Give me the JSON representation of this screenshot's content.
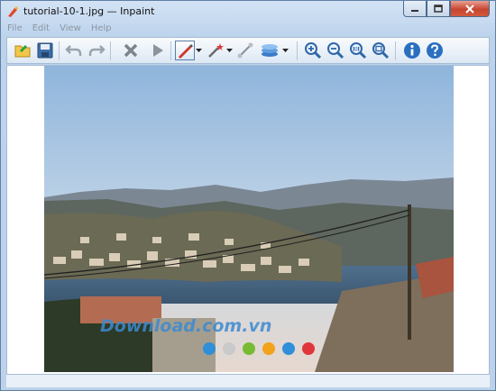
{
  "window": {
    "title": "tutorial-10-1.jpg — Inpaint"
  },
  "menu": {
    "items": [
      "File",
      "Edit",
      "View",
      "Help"
    ]
  },
  "toolbar": {
    "buttons": [
      "open-icon",
      "save-icon",
      "undo-icon",
      "redo-icon",
      "erase-icon",
      "run-icon",
      "marker-icon",
      "magic-wand-icon",
      "line-tool-icon",
      "layers-icon",
      "zoom-in-icon",
      "zoom-out-icon",
      "zoom-actual-icon",
      "zoom-fit-icon",
      "info-icon",
      "help-icon"
    ],
    "active_tool": "marker-icon"
  },
  "image": {
    "watermark_text": "Download.com.vn",
    "dot_colors": [
      "#2f8fd8",
      "#c9c9c9",
      "#77bb33",
      "#f2a21b",
      "#2f8fd8",
      "#e0353a"
    ]
  },
  "colors": {
    "accent": "#2a6fc0",
    "close_button": "#c7452f"
  }
}
